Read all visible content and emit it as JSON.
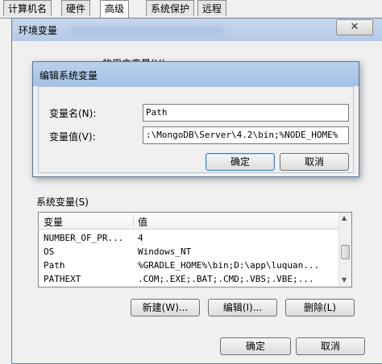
{
  "tabs": [
    {
      "label": "计算机名"
    },
    {
      "label": "硬件"
    },
    {
      "label": "高级"
    },
    {
      "label": "系统保护"
    },
    {
      "label": "远程"
    }
  ],
  "env_window": {
    "title": "环境变量",
    "user_vars_label": "的用户变量(U)",
    "system_vars_label": "系统变量(S)",
    "table": {
      "headers": [
        "变量",
        "值"
      ],
      "rows": [
        {
          "name": "NUMBER_OF_PR...",
          "value": "4"
        },
        {
          "name": "OS",
          "value": "Windows_NT"
        },
        {
          "name": "Path",
          "value": "%GRADLE_HOME%\\bin;D:\\app\\luquan..."
        },
        {
          "name": "PATHEXT",
          "value": ".COM;.EXE;.BAT;.CMD;.VBS;.VBE;..."
        }
      ]
    },
    "buttons": {
      "new": "新建(W)...",
      "edit": "编辑(I)...",
      "delete": "删除(L)"
    },
    "ok": "确定",
    "cancel": "取消"
  },
  "edit_dialog": {
    "title": "编辑系统变量",
    "name_label": "变量名(N):",
    "name_value": "Path",
    "value_label": "变量值(V):",
    "value_value": ":\\MongoDB\\Server\\4.2\\bin;%NODE_HOME%",
    "ok": "确定",
    "cancel": "取消"
  }
}
